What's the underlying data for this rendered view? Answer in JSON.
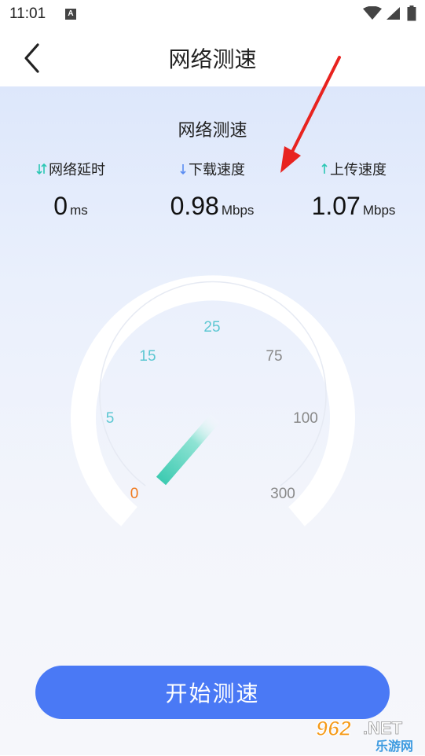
{
  "status_bar": {
    "time": "11:01",
    "notification_badge": "A"
  },
  "app_bar": {
    "title": "网络测速"
  },
  "section": {
    "title": "网络测速"
  },
  "metrics": [
    {
      "label": "网络延时",
      "value": "0",
      "unit": "ms",
      "icon": "latency-arrows-icon",
      "color": "#2bc7b4"
    },
    {
      "label": "下载速度",
      "value": "0.98",
      "unit": "Mbps",
      "icon": "download-arrow-icon",
      "color": "#5b8ef2"
    },
    {
      "label": "上传速度",
      "value": "1.07",
      "unit": "Mbps",
      "icon": "upload-arrow-icon",
      "color": "#2bc7b4"
    }
  ],
  "gauge": {
    "ticks": [
      {
        "label": "0",
        "color": "#f07a1e"
      },
      {
        "label": "5",
        "color": "#5cc7d2"
      },
      {
        "label": "15",
        "color": "#5cc7d2"
      },
      {
        "label": "25",
        "color": "#5cc7d2"
      },
      {
        "label": "75",
        "color": "#888888"
      },
      {
        "label": "100",
        "color": "#888888"
      },
      {
        "label": "300",
        "color": "#888888"
      }
    ],
    "needle_color": "#48d0b8"
  },
  "start_button": {
    "label": "开始测速",
    "color": "#4a79f5"
  },
  "watermark": {
    "brand": "962",
    "suffix": ".NET",
    "caption": "乐游网"
  }
}
